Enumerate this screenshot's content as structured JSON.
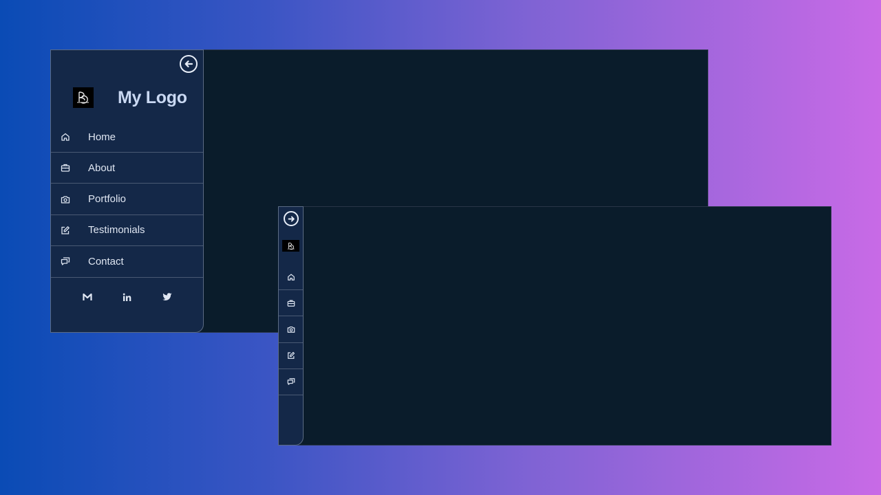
{
  "expanded": {
    "logo_text": "My Logo",
    "toggle_icon": "arrow-left-circle-icon",
    "nav": [
      {
        "label": "Home",
        "icon": "home-icon"
      },
      {
        "label": "About",
        "icon": "briefcase-icon"
      },
      {
        "label": "Portfolio",
        "icon": "camera-icon"
      },
      {
        "label": "Testimonials",
        "icon": "edit-icon"
      },
      {
        "label": "Contact",
        "icon": "chat-icon"
      }
    ],
    "socials": [
      {
        "icon": "gmail-icon"
      },
      {
        "icon": "linkedin-icon"
      },
      {
        "icon": "twitter-icon"
      }
    ]
  },
  "collapsed": {
    "toggle_icon": "arrow-right-circle-icon",
    "nav": [
      {
        "icon": "home-icon"
      },
      {
        "icon": "briefcase-icon"
      },
      {
        "icon": "camera-icon"
      },
      {
        "icon": "edit-icon"
      },
      {
        "icon": "chat-icon"
      }
    ]
  },
  "colors": {
    "sidebar_bg": "#142848",
    "content_bg": "#0a1c2b",
    "logo_text": "#c9d8f2",
    "gradient_start": "#0a4bb5",
    "gradient_end": "#c86ae6"
  }
}
